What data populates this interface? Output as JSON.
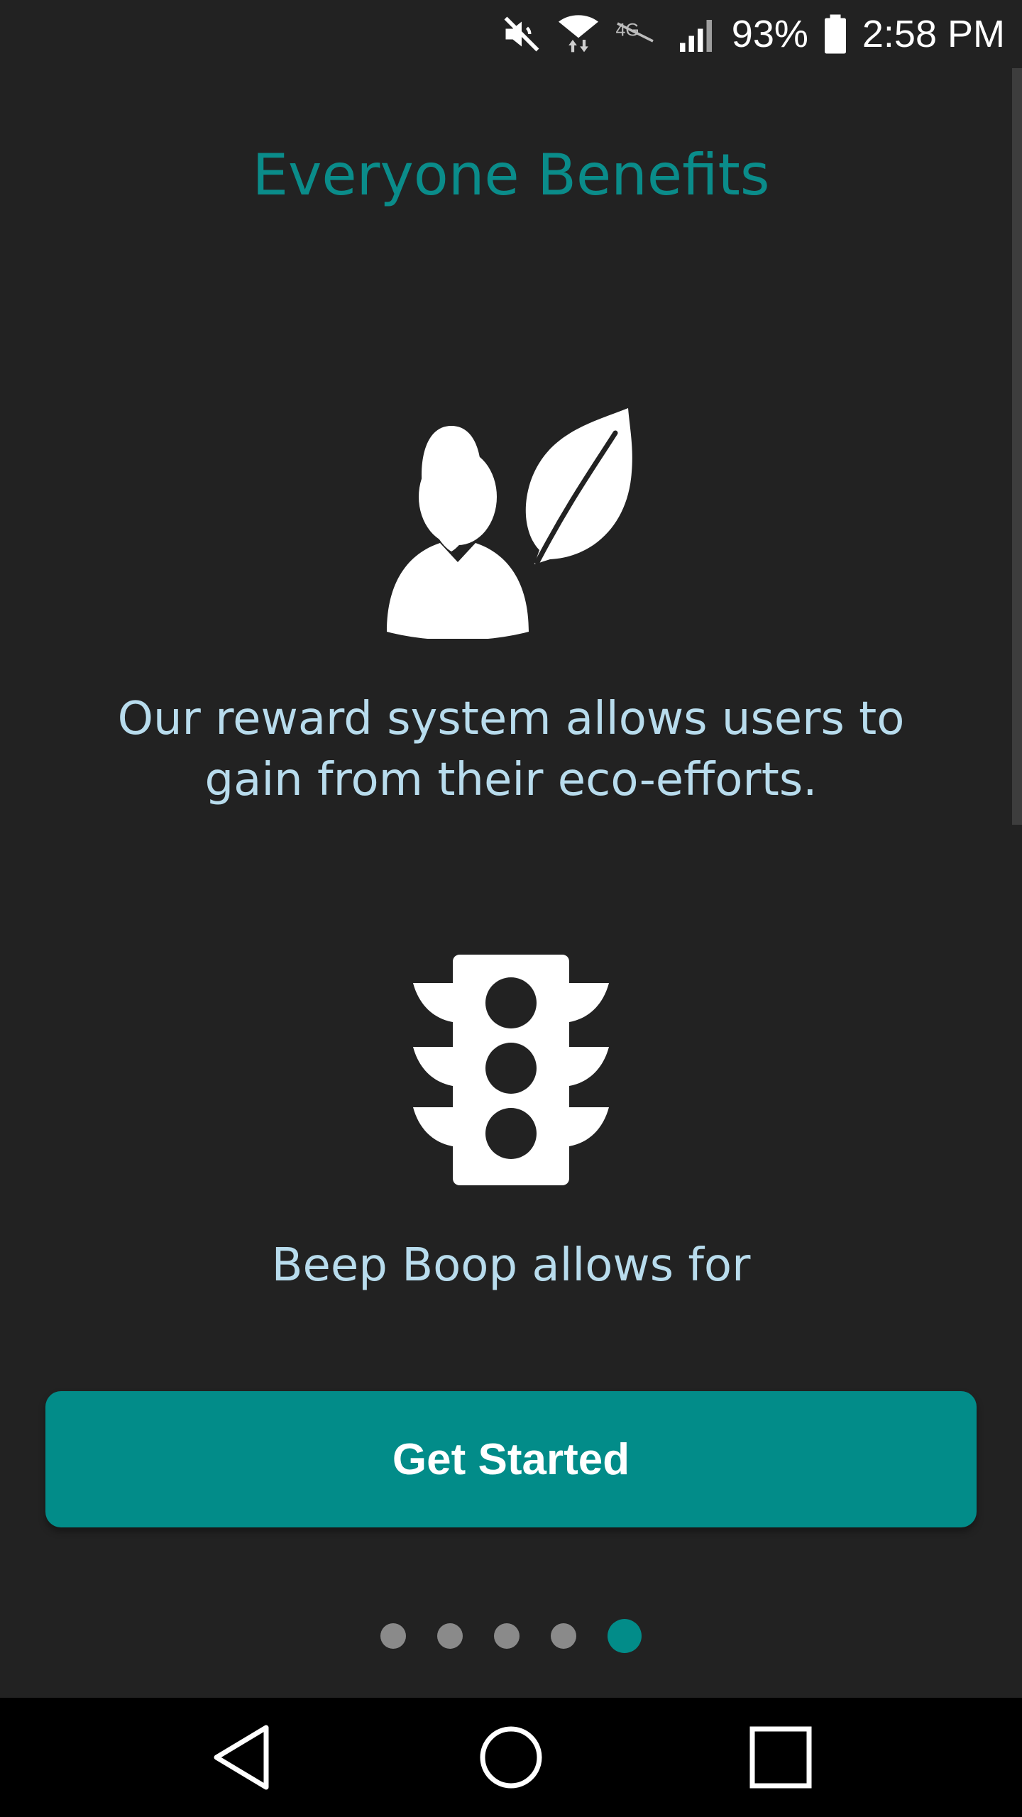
{
  "status_bar": {
    "battery_percent": "93%",
    "time": "2:58 PM",
    "icons": [
      "mute-icon",
      "wifi-icon",
      "lte-icon",
      "signal-icon",
      "battery-icon"
    ],
    "battery_level": 0.93
  },
  "onboarding": {
    "title": "Everyone Benefits",
    "features": [
      {
        "icon": "user-leaf-icon",
        "text": "Our reward system allows users to gain from their eco-efforts."
      },
      {
        "icon": "traffic-light-icon",
        "text": "Beep Boop allows for"
      }
    ],
    "cta_label": "Get Started",
    "pager": {
      "total_pages": 5,
      "current_page": 5
    }
  },
  "navigation_bar": {
    "buttons": [
      "back-icon",
      "home-icon",
      "recents-icon"
    ]
  },
  "colors": {
    "background": "#222222",
    "accent": "#028c89",
    "title": "#0a8c8a",
    "body_text": "#b8dced",
    "dot_inactive": "#8a8a8a"
  }
}
